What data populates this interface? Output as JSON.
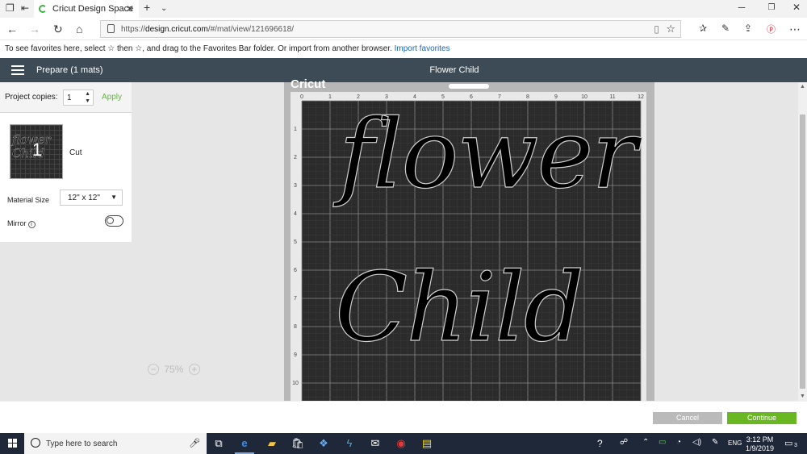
{
  "browser": {
    "tab_title": "Cricut Design Space",
    "url_prefix": "https://",
    "url_domain": "design.cricut.com",
    "url_path": "/#/mat/view/121696618/",
    "favorites_text": "To see favorites here, select ☆ then ☆, and drag to the Favorites Bar folder. Or import from another browser.",
    "import_favorites_link": "Import favorites"
  },
  "app": {
    "prepare_title": "Prepare (1 mats)",
    "project_title": "Flower Child"
  },
  "left_panel": {
    "project_copies_label": "Project copies:",
    "project_copies_value": "1",
    "apply_label": "Apply",
    "mat_number": "1",
    "mat_mode_label": "Cut",
    "material_size_label": "Material Size",
    "material_size_value": "12\" x 12\"",
    "mirror_label": "Mirror",
    "mirror_on": false
  },
  "mat": {
    "brand": "Cricut",
    "column_ticks": [
      "0",
      "1",
      "2",
      "3",
      "4",
      "5",
      "6",
      "7",
      "8",
      "9",
      "10",
      "11",
      "12"
    ],
    "row_ticks": [
      "1",
      "2",
      "3",
      "4",
      "5",
      "6",
      "7",
      "8",
      "9",
      "10"
    ],
    "design_line1": "flower",
    "design_line2": "Child"
  },
  "zoom": {
    "value": "75%"
  },
  "footer": {
    "cancel_label": "Cancel",
    "continue_label": "Continue"
  },
  "taskbar": {
    "search_placeholder": "Type here to search",
    "language": "ENG",
    "time": "3:12 PM",
    "date": "1/9/2019",
    "notification_count": "3"
  },
  "colors": {
    "header_bg": "#3c4b55",
    "mat_bg": "#2b2b2b",
    "accent_green": "#6ab821",
    "cancel_gray": "#bababa"
  }
}
